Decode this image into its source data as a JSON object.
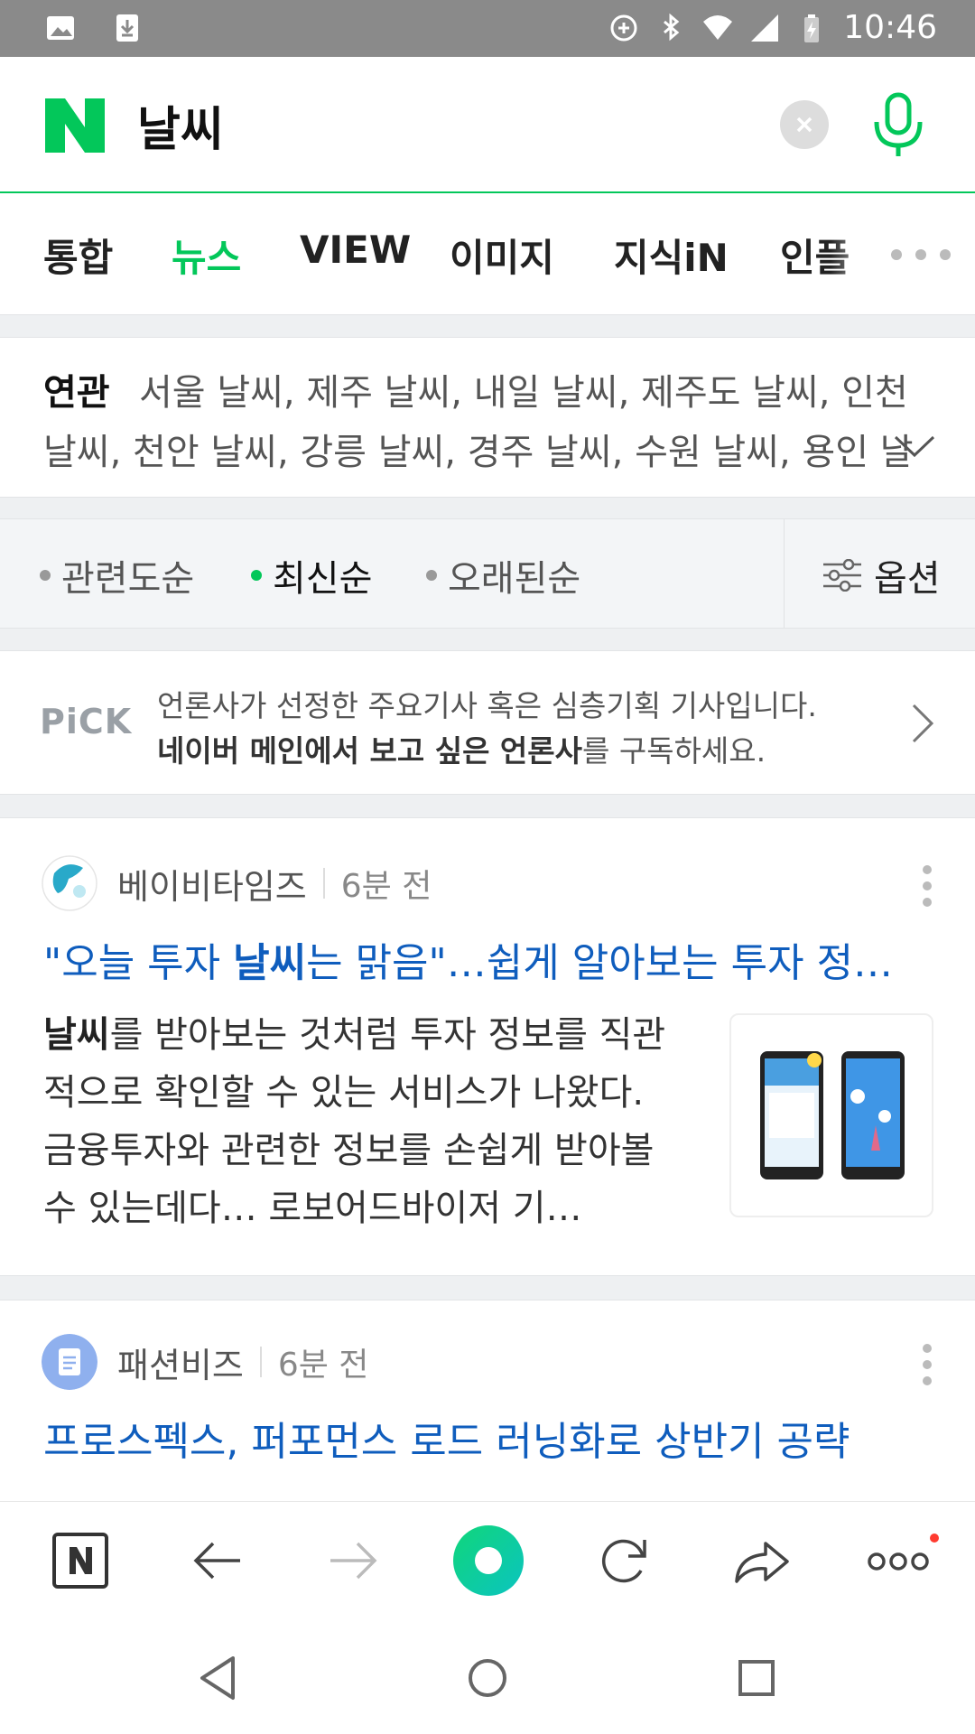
{
  "status_bar": {
    "time": "10:46",
    "icons": [
      "gallery-icon",
      "download-icon",
      "data-saver-icon",
      "bluetooth-icon",
      "wifi-icon",
      "signal-icon",
      "battery-icon"
    ]
  },
  "search": {
    "logo": "N",
    "query": "날씨"
  },
  "tabs": [
    {
      "label": "통합"
    },
    {
      "label": "뉴스"
    },
    {
      "label": "VIEW"
    },
    {
      "label": "이미지"
    },
    {
      "label": "지식iN"
    },
    {
      "label": "인플"
    }
  ],
  "related": {
    "label": "연관",
    "keywords": "서울 날씨, 제주 날씨, 내일 날씨, 제주도 날씨, 인천 날씨, 천안 날씨, 강릉 날씨, 경주 날씨, 수원 날씨, 용인 날씨"
  },
  "sort": {
    "items": [
      {
        "label": "관련도순"
      },
      {
        "label": "최신순"
      },
      {
        "label": "오래된순"
      }
    ],
    "options_label": "옵션"
  },
  "pick": {
    "logo": "PiCK",
    "line1": "언론사가 선정한 주요기사 혹은 심층기획 기사입니다.",
    "line2_bold": "네이버 메인에서 보고 싶은 언론사",
    "line2_rest": "를 구독하세요."
  },
  "articles": [
    {
      "press": "베이비타임즈",
      "time": "6분 전",
      "title_pre": "\"오늘 투자 ",
      "title_bold": "날씨",
      "title_post": "는 맑음\"…쉽게 알아보는 투자 정…",
      "body_bold": "날씨",
      "body_rest": "를 받아보는 것처럼 투자 정보를 직관적으로 확인할 수 있는 서비스가 나왔다. 금융투자와 관련한 정보를 손쉽게 받아볼 수 있는데다… 로보어드바이저 기…"
    },
    {
      "press": "패션비즈",
      "time": "6분 전",
      "title": "프로스펙스, 퍼포먼스 로드 러닝화로 상반기 공략"
    }
  ],
  "colors": {
    "brand_green": "#03c75a",
    "link_blue": "#0f5dbd",
    "status_bar": "#8a8a8a"
  }
}
